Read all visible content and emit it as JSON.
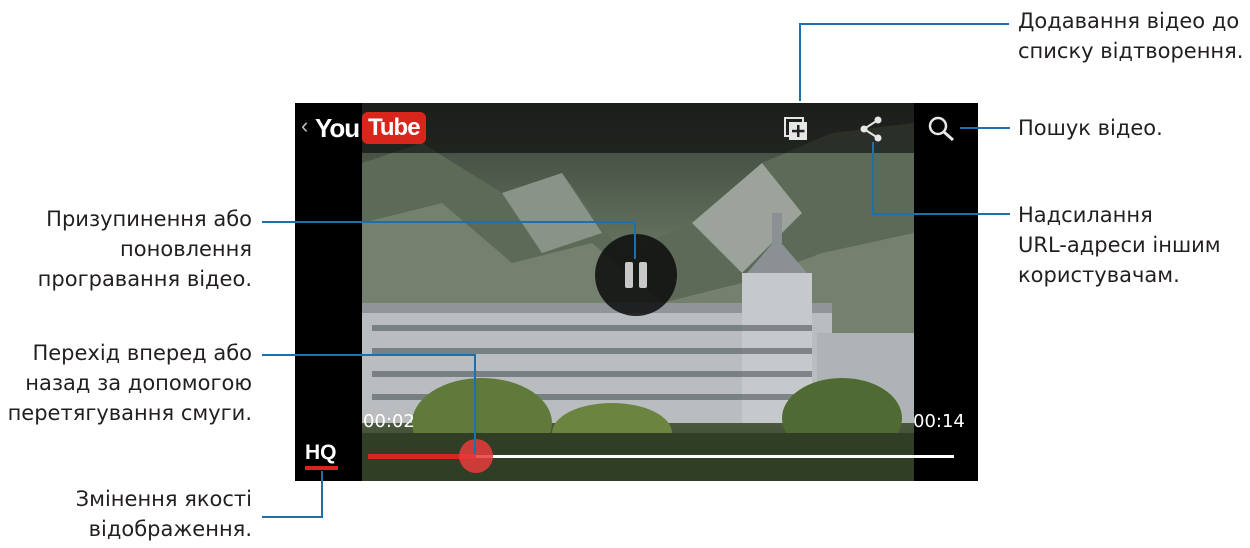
{
  "player": {
    "back_glyph": "‹",
    "logo_you": "You",
    "logo_tube": "Tube",
    "time_elapsed": "00:02",
    "time_total": "00:14",
    "progress_fraction": 0.16,
    "quality_label": "HQ",
    "icons": [
      "add-to-playlist-icon",
      "share-icon",
      "search-icon",
      "pause-icon"
    ],
    "colors": {
      "brand_red": "#d8261d",
      "callout_blue": "#1f6fa8"
    }
  },
  "callouts": {
    "playlist": [
      "Додавання відео до",
      "списку відтворення."
    ],
    "search": [
      "Пошук відео."
    ],
    "share": [
      "Надсилання",
      "URL-адреси іншим",
      "користувачам."
    ],
    "pause": [
      "Призупинення або",
      "поновлення",
      "програвання відео."
    ],
    "seek": [
      "Перехід вперед або",
      "назад за допомогою",
      "перетягування смуги."
    ],
    "quality": [
      "Змінення якості",
      "відображення."
    ]
  }
}
